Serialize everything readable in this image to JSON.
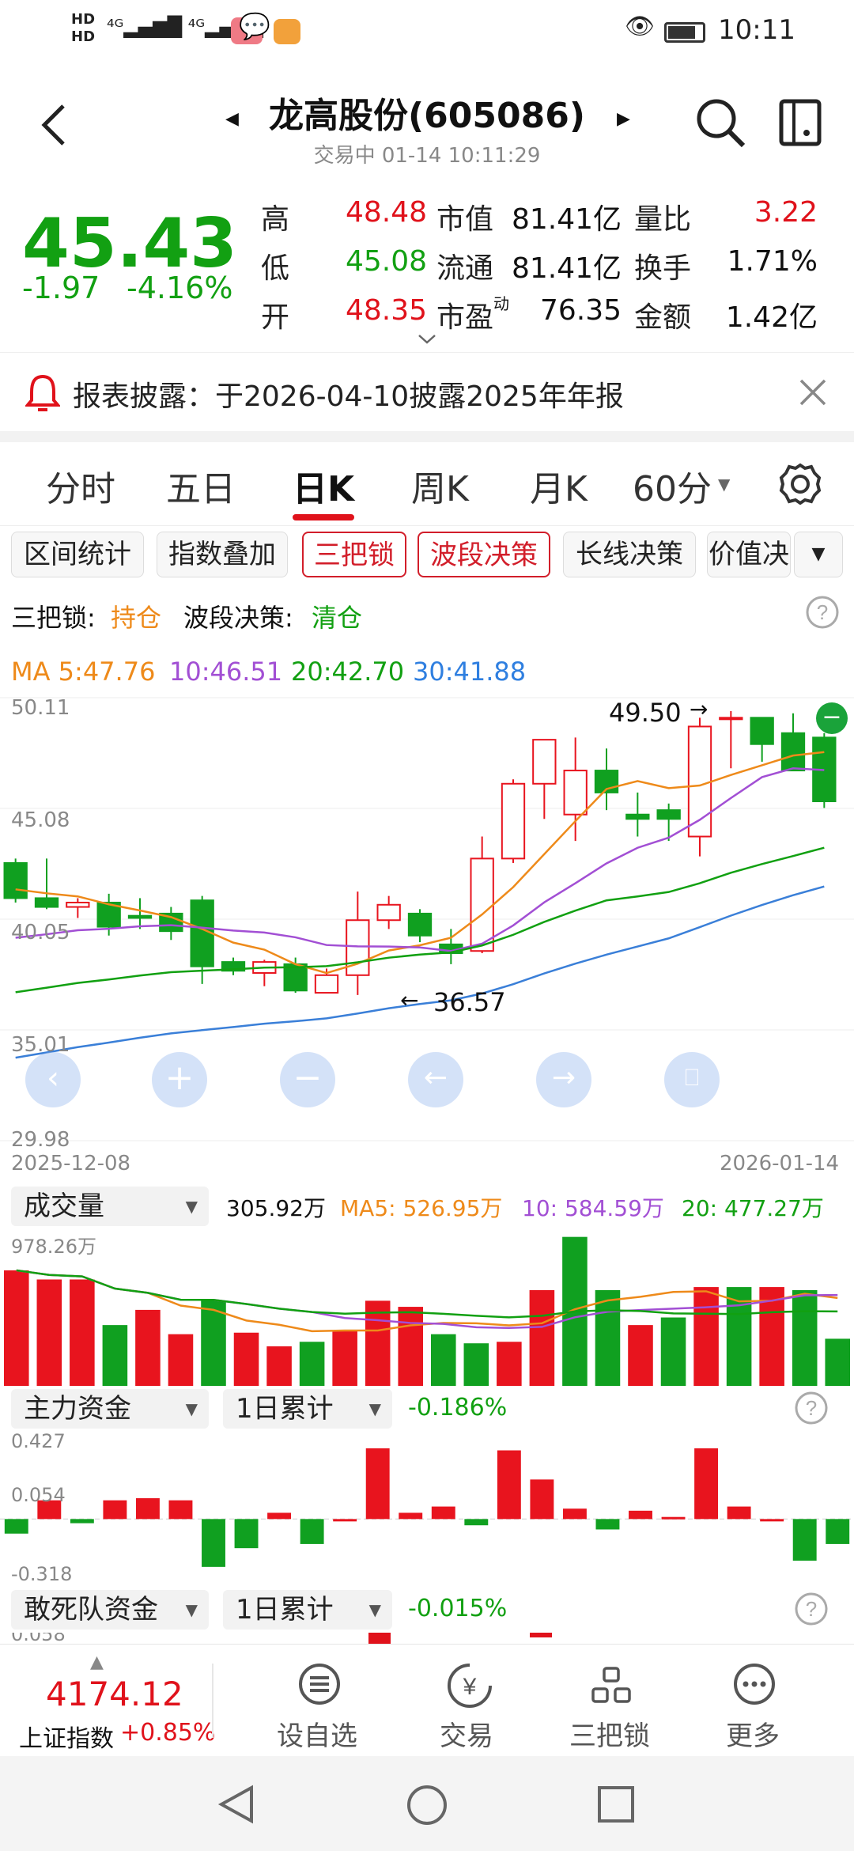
{
  "status": {
    "time": "10:11"
  },
  "header": {
    "title": "龙高股份(605086)",
    "trade_status": "交易中 01-14 10:11:29"
  },
  "quote": {
    "price": "45.43",
    "change": "-1.97",
    "change_pct": "-4.16%",
    "fields": [
      {
        "label": "高",
        "value": "48.48",
        "color": "#e0121b"
      },
      {
        "label": "低",
        "value": "45.08",
        "color": "#12a012"
      },
      {
        "label": "开",
        "value": "48.35",
        "color": "#e0121b"
      }
    ],
    "fields2": [
      {
        "label": "市值",
        "value": "81.41亿"
      },
      {
        "label": "流通",
        "value": "81.41亿"
      },
      {
        "label": "市盈",
        "sup": "动",
        "value": "76.35"
      }
    ],
    "fields3": [
      {
        "label": "量比",
        "value": "3.22",
        "color": "#e0121b"
      },
      {
        "label": "换手",
        "value": "1.71%",
        "color": "#111111"
      },
      {
        "label": "金额",
        "value": "1.42亿",
        "color": "#111111"
      }
    ]
  },
  "notice": {
    "text": "报表披露：于2026-04-10披露2025年年报"
  },
  "tabs": [
    "分时",
    "五日",
    "日K",
    "周K",
    "月K",
    "60分"
  ],
  "tools": [
    "区间统计",
    "指数叠加",
    "三把锁",
    "波段决策",
    "长线决策",
    "价值决"
  ],
  "signal": {
    "lock_label": "三把锁:",
    "lock_value": "持仓",
    "band_label": "波段决策:",
    "band_value": "清仓"
  },
  "ma": {
    "ma5": "MA 5:47.76",
    "ma10": "10:46.51",
    "ma20": "20:42.70",
    "ma30": "30:41.88"
  },
  "kline_axis": {
    "y_labels": [
      "50.11",
      "45.08",
      "40.05",
      "35.01",
      "29.98"
    ],
    "date_start": "2025-12-08",
    "date_end": "2026-01-14",
    "high_marker": "49.50",
    "low_marker": "36.57"
  },
  "volume": {
    "selector": "成交量",
    "current": "305.92万",
    "ma5": "MA5: 526.95万",
    "ma10": "10: 584.59万",
    "ma20": "20: 477.27万",
    "max_label": "978.26万"
  },
  "main_fund": {
    "selector": "主力资金",
    "period": "1日累计",
    "value": "-0.186%",
    "y_labels": [
      "0.427",
      "0.054",
      "-0.318"
    ]
  },
  "dare_fund": {
    "selector": "敢死队资金",
    "period": "1日累计",
    "value": "-0.015%",
    "y_label": "0.058"
  },
  "bottom": {
    "index_value": "4174.12",
    "index_name": "上证指数",
    "index_change": "+0.85%",
    "actions": [
      "设自选",
      "交易",
      "三把锁",
      "更多"
    ]
  },
  "chart_data": [
    {
      "type": "candlestick",
      "dates": [
        "2025-12-08",
        "2025-12-09",
        "2025-12-10",
        "2025-12-11",
        "2025-12-12",
        "2025-12-15",
        "2025-12-16",
        "2025-12-17",
        "2025-12-18",
        "2025-12-19",
        "2025-12-22",
        "2025-12-23",
        "2025-12-24",
        "2025-12-25",
        "2025-12-26",
        "2025-12-29",
        "2025-12-30",
        "2025-12-31",
        "2026-01-02",
        "2026-01-05",
        "2026-01-06",
        "2026-01-07",
        "2026-01-08",
        "2026-01-09",
        "2026-01-12",
        "2026-01-13",
        "2026-01-14"
      ],
      "ohlc": [
        [
          42.6,
          42.8,
          40.8,
          41.0
        ],
        [
          41.0,
          42.8,
          40.5,
          40.6
        ],
        [
          40.6,
          41.0,
          40.1,
          40.8
        ],
        [
          40.8,
          41.2,
          39.3,
          39.7
        ],
        [
          40.2,
          41.0,
          39.6,
          40.1
        ],
        [
          40.3,
          40.6,
          39.1,
          39.5
        ],
        [
          40.9,
          41.1,
          37.1,
          37.9
        ],
        [
          38.1,
          38.3,
          37.5,
          37.7
        ],
        [
          37.6,
          38.2,
          37.0,
          38.1
        ],
        [
          38.0,
          38.3,
          36.7,
          36.8
        ],
        [
          36.7,
          37.8,
          36.7,
          37.5
        ],
        [
          37.5,
          41.3,
          36.6,
          40.0
        ],
        [
          40.0,
          41.1,
          39.6,
          40.7
        ],
        [
          40.3,
          40.5,
          39.0,
          39.3
        ],
        [
          38.9,
          39.6,
          38.0,
          38.5
        ],
        [
          38.6,
          43.8,
          38.5,
          42.8
        ],
        [
          42.8,
          46.4,
          42.6,
          46.2
        ],
        [
          46.2,
          48.2,
          44.6,
          48.2
        ],
        [
          44.8,
          48.3,
          43.6,
          46.8
        ],
        [
          46.8,
          47.8,
          45.0,
          45.8
        ],
        [
          44.8,
          45.8,
          43.8,
          44.6
        ],
        [
          45.0,
          45.3,
          43.6,
          44.6
        ],
        [
          43.8,
          49.2,
          42.9,
          48.8
        ],
        [
          49.2,
          49.5,
          46.9,
          49.2
        ],
        [
          49.2,
          49.2,
          47.2,
          48.0
        ],
        [
          48.5,
          49.4,
          47.0,
          46.8
        ],
        [
          48.3,
          48.5,
          45.1,
          45.4
        ]
      ],
      "ma": {
        "ma5": "47.76",
        "ma10": "46.51",
        "ma20": "42.70",
        "ma30": "41.88"
      },
      "ylim": [
        29.98,
        50.11
      ]
    },
    {
      "type": "bar",
      "name": "成交量",
      "values": [
        760,
        700,
        700,
        400,
        500,
        340,
        560,
        350,
        260,
        290,
        360,
        560,
        520,
        340,
        280,
        290,
        630,
        980,
        630,
        400,
        450,
        650,
        650,
        650,
        630,
        310
      ],
      "colors": [
        "r",
        "r",
        "r",
        "g",
        "r",
        "r",
        "g",
        "r",
        "r",
        "g",
        "r",
        "r",
        "r",
        "g",
        "g",
        "r",
        "r",
        "g",
        "g",
        "r",
        "g",
        "r",
        "g",
        "r",
        "g",
        "g"
      ],
      "ylim": [
        0,
        978.26
      ]
    },
    {
      "type": "bar",
      "name": "主力资金",
      "values": [
        -0.07,
        0.09,
        -0.02,
        0.09,
        0.1,
        0.09,
        -0.23,
        -0.14,
        0.03,
        -0.12,
        0.0,
        0.34,
        0.03,
        0.06,
        -0.03,
        0.33,
        0.19,
        0.05,
        -0.05,
        0.04,
        0.01,
        0.34,
        0.06,
        0.0,
        -0.2,
        -0.12
      ],
      "ylim": [
        -0.318,
        0.427
      ]
    }
  ]
}
